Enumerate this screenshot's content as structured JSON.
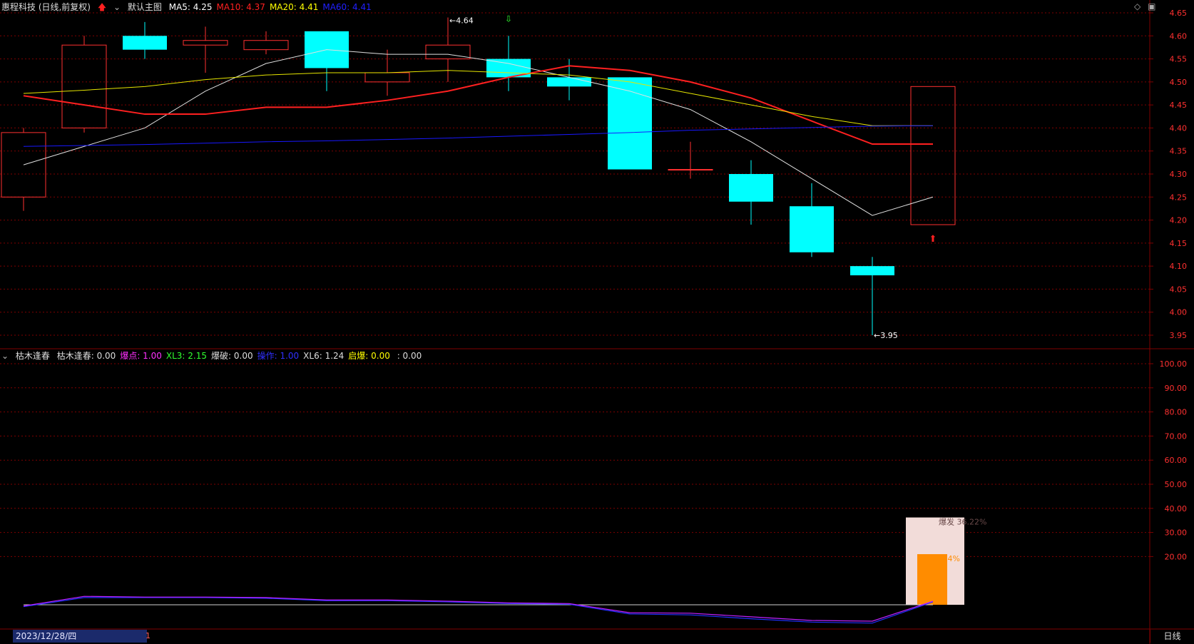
{
  "header": {
    "stock_title": "惠程科技 (日线,前复权)",
    "up_arrow_icon": "red-up-arrow-icon",
    "dropdown_icon": "circle-chevron-down-icon",
    "main_chart_name": "默认主图",
    "ma_labels": [
      {
        "text": "MA5: 4.25",
        "color": "#ffffff"
      },
      {
        "text": "MA10: 4.37",
        "color": "#ff2020"
      },
      {
        "text": "MA20: 4.41",
        "color": "#ffff00"
      },
      {
        "text": "MA60: 4.41",
        "color": "#2020ff"
      }
    ]
  },
  "indicator_header": {
    "dropdown_icon": "circle-chevron-down-icon",
    "name": "枯木逢春",
    "items": [
      {
        "text": "枯木逢春: 0.00",
        "color": "#dddddd"
      },
      {
        "text": "爆点: 1.00",
        "color": "#ff30ff"
      },
      {
        "text": "XL3: 2.15",
        "color": "#30ff30"
      },
      {
        "text": "爆破: 0.00",
        "color": "#dddddd"
      },
      {
        "text": "操作: 1.00",
        "color": "#3030ff"
      },
      {
        "text": "XL6: 1.24",
        "color": "#dddddd"
      },
      {
        "text": "启爆: 0.00",
        "color": "#ffff00"
      },
      {
        "text": "      : 0.00",
        "color": "#dddddd"
      }
    ]
  },
  "footer": {
    "date": "2023/12/28/四",
    "period": "日线",
    "cursor_mark": "1"
  },
  "corner_icons": [
    "diamond-icon",
    "maximize-icon"
  ],
  "colors": {
    "up": "#ff3030",
    "down": "#00ffff",
    "grid": "#800000",
    "axis_text": "#ff3030"
  },
  "chart_data": [
    {
      "type": "candlestick",
      "title": "惠程科技 (日线,前复权)",
      "ylim": [
        3.92,
        4.67
      ],
      "yticks": [
        3.95,
        4.0,
        4.05,
        4.1,
        4.15,
        4.2,
        4.25,
        4.3,
        4.35,
        4.4,
        4.45,
        4.5,
        4.55,
        4.6,
        4.65
      ],
      "candles": [
        {
          "open": 4.25,
          "high": 4.4,
          "low": 4.22,
          "close": 4.39
        },
        {
          "open": 4.4,
          "high": 4.6,
          "low": 4.39,
          "close": 4.58
        },
        {
          "open": 4.6,
          "high": 4.63,
          "low": 4.55,
          "close": 4.57
        },
        {
          "open": 4.58,
          "high": 4.62,
          "low": 4.52,
          "close": 4.59
        },
        {
          "open": 4.57,
          "high": 4.61,
          "low": 4.56,
          "close": 4.59
        },
        {
          "open": 4.61,
          "high": 4.61,
          "low": 4.48,
          "close": 4.53
        },
        {
          "open": 4.5,
          "high": 4.57,
          "low": 4.47,
          "close": 4.52
        },
        {
          "open": 4.55,
          "high": 4.64,
          "low": 4.5,
          "close": 4.58
        },
        {
          "open": 4.55,
          "high": 4.6,
          "low": 4.48,
          "close": 4.51
        },
        {
          "open": 4.51,
          "high": 4.55,
          "low": 4.46,
          "close": 4.49
        },
        {
          "open": 4.51,
          "high": 4.51,
          "low": 4.31,
          "close": 4.31
        },
        {
          "open": 4.31,
          "high": 4.37,
          "low": 4.29,
          "close": 4.31
        },
        {
          "open": 4.3,
          "high": 4.33,
          "low": 4.19,
          "close": 4.24
        },
        {
          "open": 4.23,
          "high": 4.28,
          "low": 4.12,
          "close": 4.13
        },
        {
          "open": 4.1,
          "high": 4.12,
          "low": 3.95,
          "close": 4.08
        },
        {
          "open": 4.19,
          "high": 4.49,
          "low": 4.19,
          "close": 4.49
        }
      ],
      "ma_series": [
        {
          "name": "MA5",
          "color": "#e0e0e0",
          "width": 1,
          "values": [
            4.32,
            4.36,
            4.4,
            4.48,
            4.54,
            4.57,
            4.56,
            4.56,
            4.54,
            4.51,
            4.48,
            4.44,
            4.37,
            4.29,
            4.21,
            4.25
          ]
        },
        {
          "name": "MA10",
          "color": "#ff2020",
          "width": 2,
          "values": [
            4.47,
            4.45,
            4.43,
            4.43,
            4.445,
            4.445,
            4.46,
            4.48,
            4.51,
            4.535,
            4.525,
            4.5,
            4.465,
            4.415,
            4.365,
            4.365
          ]
        },
        {
          "name": "MA20",
          "color": "#e6e600",
          "width": 1,
          "values": [
            4.475,
            4.482,
            4.49,
            4.505,
            4.515,
            4.52,
            4.52,
            4.525,
            4.52,
            4.515,
            4.5,
            4.475,
            4.45,
            4.425,
            4.405,
            4.405
          ]
        },
        {
          "name": "MA60",
          "color": "#1818ff",
          "width": 1,
          "values": [
            4.36,
            4.362,
            4.364,
            4.367,
            4.37,
            4.372,
            4.375,
            4.378,
            4.382,
            4.386,
            4.39,
            4.395,
            4.398,
            4.401,
            4.404,
            4.405
          ]
        }
      ],
      "annotations": [
        {
          "text": "4.64",
          "candle": 7,
          "kind": "high"
        },
        {
          "text": "3.95",
          "candle": 14,
          "kind": "low"
        }
      ],
      "signals": [
        {
          "candle": 8,
          "kind": "green-down-arrow-icon"
        },
        {
          "candle": 15,
          "kind": "red-up-arrow-icon"
        }
      ]
    },
    {
      "type": "indicator",
      "title": "枯木逢春",
      "yticks": [
        20,
        30,
        40,
        50,
        60,
        70,
        80,
        90,
        100
      ],
      "ylim": [
        0,
        105
      ],
      "purple_line": [
        -0.5,
        3.5,
        3.2,
        3.2,
        3.0,
        2.0,
        2.0,
        1.5,
        0.8,
        0.5,
        -3.3,
        -3.5,
        -5.0,
        -6.5,
        -6.8,
        1.5
      ],
      "blue_line": [
        -0.8,
        3.0,
        3.0,
        3.0,
        2.7,
        1.7,
        1.7,
        1.2,
        0.5,
        0.2,
        -3.8,
        -4.2,
        -5.8,
        -7.2,
        -7.6,
        1.2
      ],
      "baseline": 0,
      "bars": [
        {
          "candle": 15,
          "label": "爆发 36.22%",
          "value": 36.22,
          "color": "#f2dcd9"
        },
        {
          "candle": 15,
          "label": "60.64%",
          "value": 21.0,
          "color": "#ff8c00"
        }
      ]
    }
  ]
}
